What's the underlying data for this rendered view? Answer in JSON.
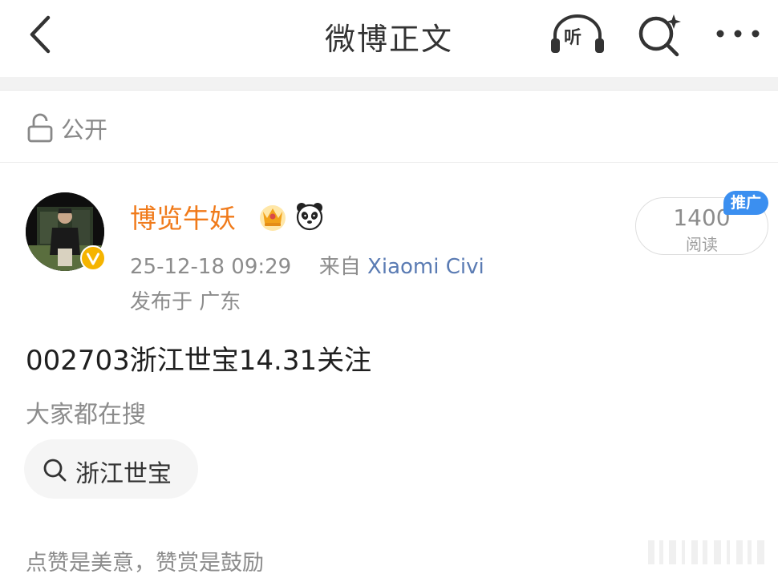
{
  "header": {
    "title": "微博正文",
    "listen_label": "听"
  },
  "visibility": {
    "label": "公开"
  },
  "post": {
    "author_name": "博览牛妖",
    "timestamp": "25-12-18 09:29",
    "source_prefix": "来自",
    "source_device": "Xiaomi Civi",
    "location": "发布于 广东",
    "read_count": "1400",
    "read_label": "阅读",
    "promo_tag": "推广",
    "body": "002703浙江世宝14.31关注"
  },
  "search_section": {
    "heading": "大家都在搜",
    "chip_label": "浙江世宝"
  },
  "footer": {
    "reward_text": "点赞是美意，赞赏是鼓励"
  },
  "colors": {
    "author_name": "#f07a1a",
    "source_link": "#5a7bb3",
    "promo_tag": "#3b8ff0",
    "verified_badge": "#f5b400"
  },
  "icons": {
    "back": "chevron-left-icon",
    "listen": "headphones-icon",
    "search": "search-sparkle-icon",
    "more": "more-dots-icon",
    "lock": "unlock-icon",
    "verified": "verified-badge-icon",
    "crown": "crown-icon",
    "panda": "panda-icon",
    "chip_search": "search-icon"
  }
}
